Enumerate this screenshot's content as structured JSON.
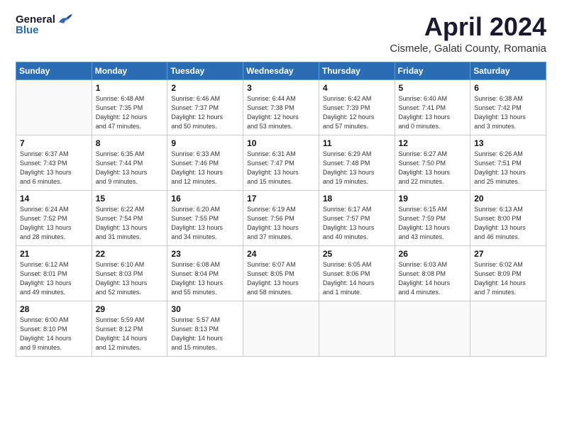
{
  "logo": {
    "general": "General",
    "blue": "Blue"
  },
  "title": "April 2024",
  "subtitle": "Cismele, Galati County, Romania",
  "weekdays": [
    "Sunday",
    "Monday",
    "Tuesday",
    "Wednesday",
    "Thursday",
    "Friday",
    "Saturday"
  ],
  "weeks": [
    [
      {
        "day": "",
        "info": ""
      },
      {
        "day": "1",
        "info": "Sunrise: 6:48 AM\nSunset: 7:35 PM\nDaylight: 12 hours\nand 47 minutes."
      },
      {
        "day": "2",
        "info": "Sunrise: 6:46 AM\nSunset: 7:37 PM\nDaylight: 12 hours\nand 50 minutes."
      },
      {
        "day": "3",
        "info": "Sunrise: 6:44 AM\nSunset: 7:38 PM\nDaylight: 12 hours\nand 53 minutes."
      },
      {
        "day": "4",
        "info": "Sunrise: 6:42 AM\nSunset: 7:39 PM\nDaylight: 12 hours\nand 57 minutes."
      },
      {
        "day": "5",
        "info": "Sunrise: 6:40 AM\nSunset: 7:41 PM\nDaylight: 13 hours\nand 0 minutes."
      },
      {
        "day": "6",
        "info": "Sunrise: 6:38 AM\nSunset: 7:42 PM\nDaylight: 13 hours\nand 3 minutes."
      }
    ],
    [
      {
        "day": "7",
        "info": "Sunrise: 6:37 AM\nSunset: 7:43 PM\nDaylight: 13 hours\nand 6 minutes."
      },
      {
        "day": "8",
        "info": "Sunrise: 6:35 AM\nSunset: 7:44 PM\nDaylight: 13 hours\nand 9 minutes."
      },
      {
        "day": "9",
        "info": "Sunrise: 6:33 AM\nSunset: 7:46 PM\nDaylight: 13 hours\nand 12 minutes."
      },
      {
        "day": "10",
        "info": "Sunrise: 6:31 AM\nSunset: 7:47 PM\nDaylight: 13 hours\nand 15 minutes."
      },
      {
        "day": "11",
        "info": "Sunrise: 6:29 AM\nSunset: 7:48 PM\nDaylight: 13 hours\nand 19 minutes."
      },
      {
        "day": "12",
        "info": "Sunrise: 6:27 AM\nSunset: 7:50 PM\nDaylight: 13 hours\nand 22 minutes."
      },
      {
        "day": "13",
        "info": "Sunrise: 6:26 AM\nSunset: 7:51 PM\nDaylight: 13 hours\nand 25 minutes."
      }
    ],
    [
      {
        "day": "14",
        "info": "Sunrise: 6:24 AM\nSunset: 7:52 PM\nDaylight: 13 hours\nand 28 minutes."
      },
      {
        "day": "15",
        "info": "Sunrise: 6:22 AM\nSunset: 7:54 PM\nDaylight: 13 hours\nand 31 minutes."
      },
      {
        "day": "16",
        "info": "Sunrise: 6:20 AM\nSunset: 7:55 PM\nDaylight: 13 hours\nand 34 minutes."
      },
      {
        "day": "17",
        "info": "Sunrise: 6:19 AM\nSunset: 7:56 PM\nDaylight: 13 hours\nand 37 minutes."
      },
      {
        "day": "18",
        "info": "Sunrise: 6:17 AM\nSunset: 7:57 PM\nDaylight: 13 hours\nand 40 minutes."
      },
      {
        "day": "19",
        "info": "Sunrise: 6:15 AM\nSunset: 7:59 PM\nDaylight: 13 hours\nand 43 minutes."
      },
      {
        "day": "20",
        "info": "Sunrise: 6:13 AM\nSunset: 8:00 PM\nDaylight: 13 hours\nand 46 minutes."
      }
    ],
    [
      {
        "day": "21",
        "info": "Sunrise: 6:12 AM\nSunset: 8:01 PM\nDaylight: 13 hours\nand 49 minutes."
      },
      {
        "day": "22",
        "info": "Sunrise: 6:10 AM\nSunset: 8:03 PM\nDaylight: 13 hours\nand 52 minutes."
      },
      {
        "day": "23",
        "info": "Sunrise: 6:08 AM\nSunset: 8:04 PM\nDaylight: 13 hours\nand 55 minutes."
      },
      {
        "day": "24",
        "info": "Sunrise: 6:07 AM\nSunset: 8:05 PM\nDaylight: 13 hours\nand 58 minutes."
      },
      {
        "day": "25",
        "info": "Sunrise: 6:05 AM\nSunset: 8:06 PM\nDaylight: 14 hours\nand 1 minute."
      },
      {
        "day": "26",
        "info": "Sunrise: 6:03 AM\nSunset: 8:08 PM\nDaylight: 14 hours\nand 4 minutes."
      },
      {
        "day": "27",
        "info": "Sunrise: 6:02 AM\nSunset: 8:09 PM\nDaylight: 14 hours\nand 7 minutes."
      }
    ],
    [
      {
        "day": "28",
        "info": "Sunrise: 6:00 AM\nSunset: 8:10 PM\nDaylight: 14 hours\nand 9 minutes."
      },
      {
        "day": "29",
        "info": "Sunrise: 5:59 AM\nSunset: 8:12 PM\nDaylight: 14 hours\nand 12 minutes."
      },
      {
        "day": "30",
        "info": "Sunrise: 5:57 AM\nSunset: 8:13 PM\nDaylight: 14 hours\nand 15 minutes."
      },
      {
        "day": "",
        "info": ""
      },
      {
        "day": "",
        "info": ""
      },
      {
        "day": "",
        "info": ""
      },
      {
        "day": "",
        "info": ""
      }
    ]
  ]
}
